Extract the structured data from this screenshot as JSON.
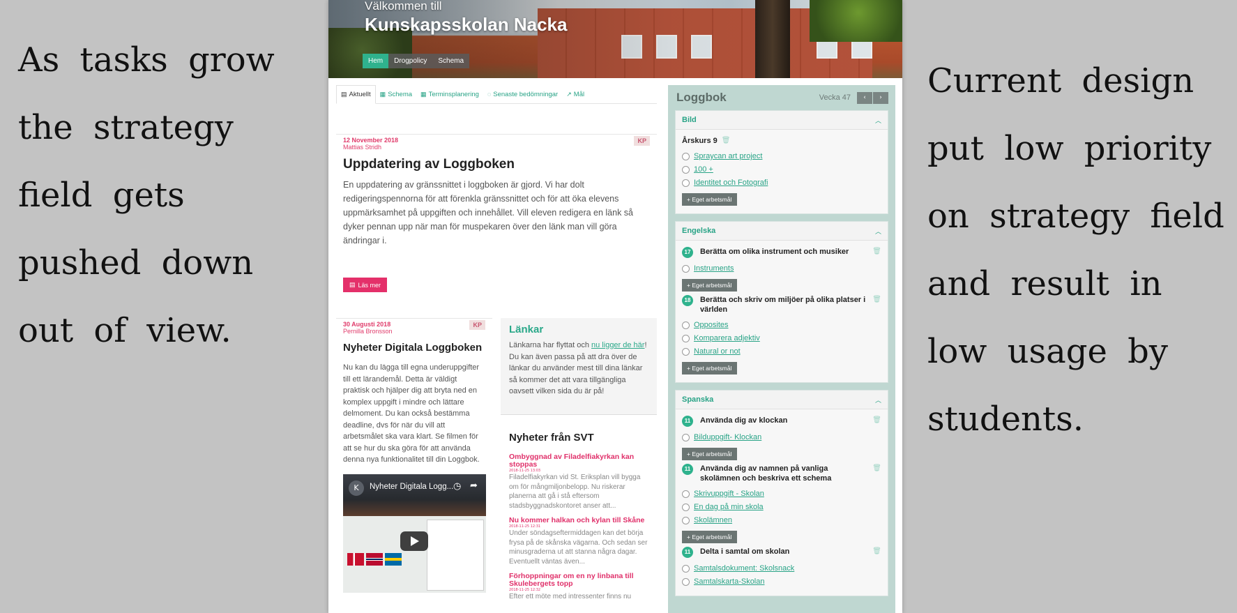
{
  "notes": {
    "left": "As tasks grow the strategy field gets pushed down out of view.",
    "right": "Current design put low priority on strategy field and result in low usage by students."
  },
  "header": {
    "subtitle": "Välkommen till",
    "title": "Kunskapsskolan Nacka",
    "nav": [
      "Hem",
      "Drogpolicy",
      "Schema"
    ]
  },
  "tabs": [
    {
      "label": "Aktuellt",
      "icon": "newspaper-icon"
    },
    {
      "label": "Schema",
      "icon": "calendar-icon"
    },
    {
      "label": "Terminsplanering",
      "icon": "calendar-icon"
    },
    {
      "label": "Senaste bedömningar",
      "icon": "comment-icon"
    },
    {
      "label": "Mål",
      "icon": "chart-icon"
    }
  ],
  "post1": {
    "date": "12 November 2018",
    "author": "Mattias Stridh",
    "badge": "KP",
    "title": "Uppdatering av Loggboken",
    "body": "En uppdatering av gränssnittet i loggboken är gjord. Vi har dolt redigeringspennorna för att förenkla gränssnittet och för att öka elevens uppmärksamhet på uppgiften och innehållet. Vill eleven redigera en länk så dyker pennan upp när man för muspekaren över den länk man vill göra ändringar i.",
    "read_more": "Läs mer"
  },
  "post2": {
    "date": "30 Augusti 2018",
    "author": "Pernilla Bronsson",
    "badge": "KP",
    "title": "Nyheter Digitala Loggboken",
    "body": "Nu kan du lägga till egna underuppgifter till ett lärandemål. Detta är väldigt praktisk och hjälper dig att bryta ned en komplex uppgift i mindre och lättare delmoment. Du kan också bestämma deadline, dvs för när du vill att arbetsmålet ska vara klart. Se filmen för att se hur du ska göra för att använda denna nya funktionalitet till din Loggbok.",
    "video_title": "Nyheter Digitala Logg...",
    "video_avatar": "K"
  },
  "links_box": {
    "title": "Länkar",
    "text_before": "Länkarna har flyttat och ",
    "link": "nu ligger de här",
    "text_after": "! Du kan även passa på att dra över de länkar du använder mest till dina länkar så kommer det att vara tillgängliga oavsett vilken sida du är på!"
  },
  "svt": {
    "title": "Nyheter från SVT",
    "items": [
      {
        "title": "Ombyggnad av Filadelfiakyrkan kan stoppas",
        "date": "2018-11-25 13:03",
        "text": "Filadelfiakyrkan vid St. Eriksplan vill bygga om för mångmiljonbelopp. Nu riskerar planerna att gå i stå eftersom stadsbyggnadskontoret anser att..."
      },
      {
        "title": "Nu kommer halkan och kylan till Skåne",
        "date": "2018-11-25 12:31",
        "text": "Under söndagseftermiddagen kan det börja frysa på de skånska vägarna. Och sedan ser minusgraderna ut att stanna några dagar. Eventuellt väntas även..."
      },
      {
        "title": "Förhoppningar om en ny linbana till Skulebergets topp",
        "date": "2018-11-25 12:32",
        "text": "Efter ett möte med intressenter finns nu"
      }
    ]
  },
  "logbook": {
    "title": "Loggbok",
    "week": "Vecka 47",
    "prev": "‹",
    "next": "›",
    "add_label": "Eget arbetsmål",
    "cards": [
      {
        "name": "Bild",
        "heading": "Årskurs 9",
        "tasks": [
          "Spraycan art project",
          "100 +",
          "Identitet och Fotografi"
        ]
      },
      {
        "name": "Engelska",
        "goals": [
          {
            "num": "17",
            "text": "Berätta om olika instrument och musiker",
            "tasks": [
              "Instruments"
            ]
          },
          {
            "num": "18",
            "text": "Berätta och skriv om miljöer på olika platser i världen",
            "tasks": [
              "Opposites",
              "Komparera adjektiv",
              "Natural or not"
            ]
          }
        ]
      },
      {
        "name": "Spanska",
        "goals": [
          {
            "num": "11",
            "text": "Använda dig av klockan",
            "tasks": [
              "Bilduppgift- Klockan"
            ]
          },
          {
            "num": "11",
            "text": "Använda dig av namnen på vanliga skolämnen och beskriva ett schema",
            "tasks": [
              "Skrivuppgift - Skolan",
              "En dag på min skola",
              "Skolämnen"
            ]
          },
          {
            "num": "11",
            "text": "Delta i samtal om skolan",
            "tasks": [
              "Samtalsdokument: Skolsnack",
              "Samtalskarta-Skolan"
            ]
          }
        ]
      }
    ]
  },
  "colors": {
    "accent": "#2fb28d",
    "pink": "#e4306a",
    "sidebar_bg": "#bfd7d1"
  }
}
